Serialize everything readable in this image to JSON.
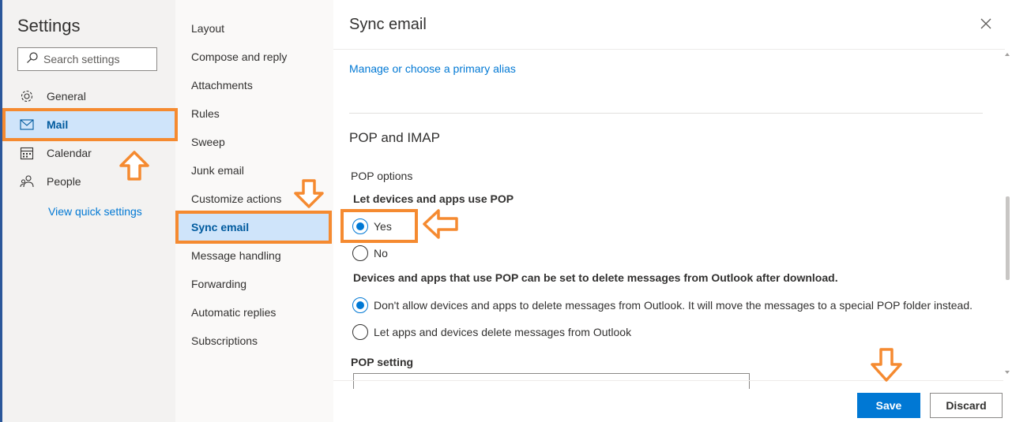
{
  "settings_panel": {
    "title": "Settings",
    "search_placeholder": "Search settings",
    "nav": [
      {
        "label": "General",
        "icon": "gear-icon"
      },
      {
        "label": "Mail",
        "icon": "mail-icon",
        "selected": true
      },
      {
        "label": "Calendar",
        "icon": "calendar-icon"
      },
      {
        "label": "People",
        "icon": "people-icon"
      }
    ],
    "quick_settings_link": "View quick settings"
  },
  "mail_sections": [
    "Layout",
    "Compose and reply",
    "Attachments",
    "Rules",
    "Sweep",
    "Junk email",
    "Customize actions",
    "Sync email",
    "Message handling",
    "Forwarding",
    "Automatic replies",
    "Subscriptions"
  ],
  "selected_section": "Sync email",
  "content": {
    "title": "Sync email",
    "alias_link": "Manage or choose a primary alias",
    "section_heading": "POP and IMAP",
    "pop_options_label": "POP options",
    "let_pop_label": "Let devices and apps use POP",
    "pop_yes": "Yes",
    "pop_no": "No",
    "pop_enabled": true,
    "delete_label": "Devices and apps that use POP can be set to delete messages from Outlook after download.",
    "delete_opt1": "Don't allow devices and apps to delete messages from Outlook. It will move the messages to a special POP folder instead.",
    "delete_opt2": "Let apps and devices delete messages from Outlook",
    "pop_setting_label": "POP setting"
  },
  "footer": {
    "save": "Save",
    "discard": "Discard"
  },
  "colors": {
    "accent": "#0078d4",
    "highlight": "#f58a30",
    "selected_bg": "#cfe4fa"
  }
}
